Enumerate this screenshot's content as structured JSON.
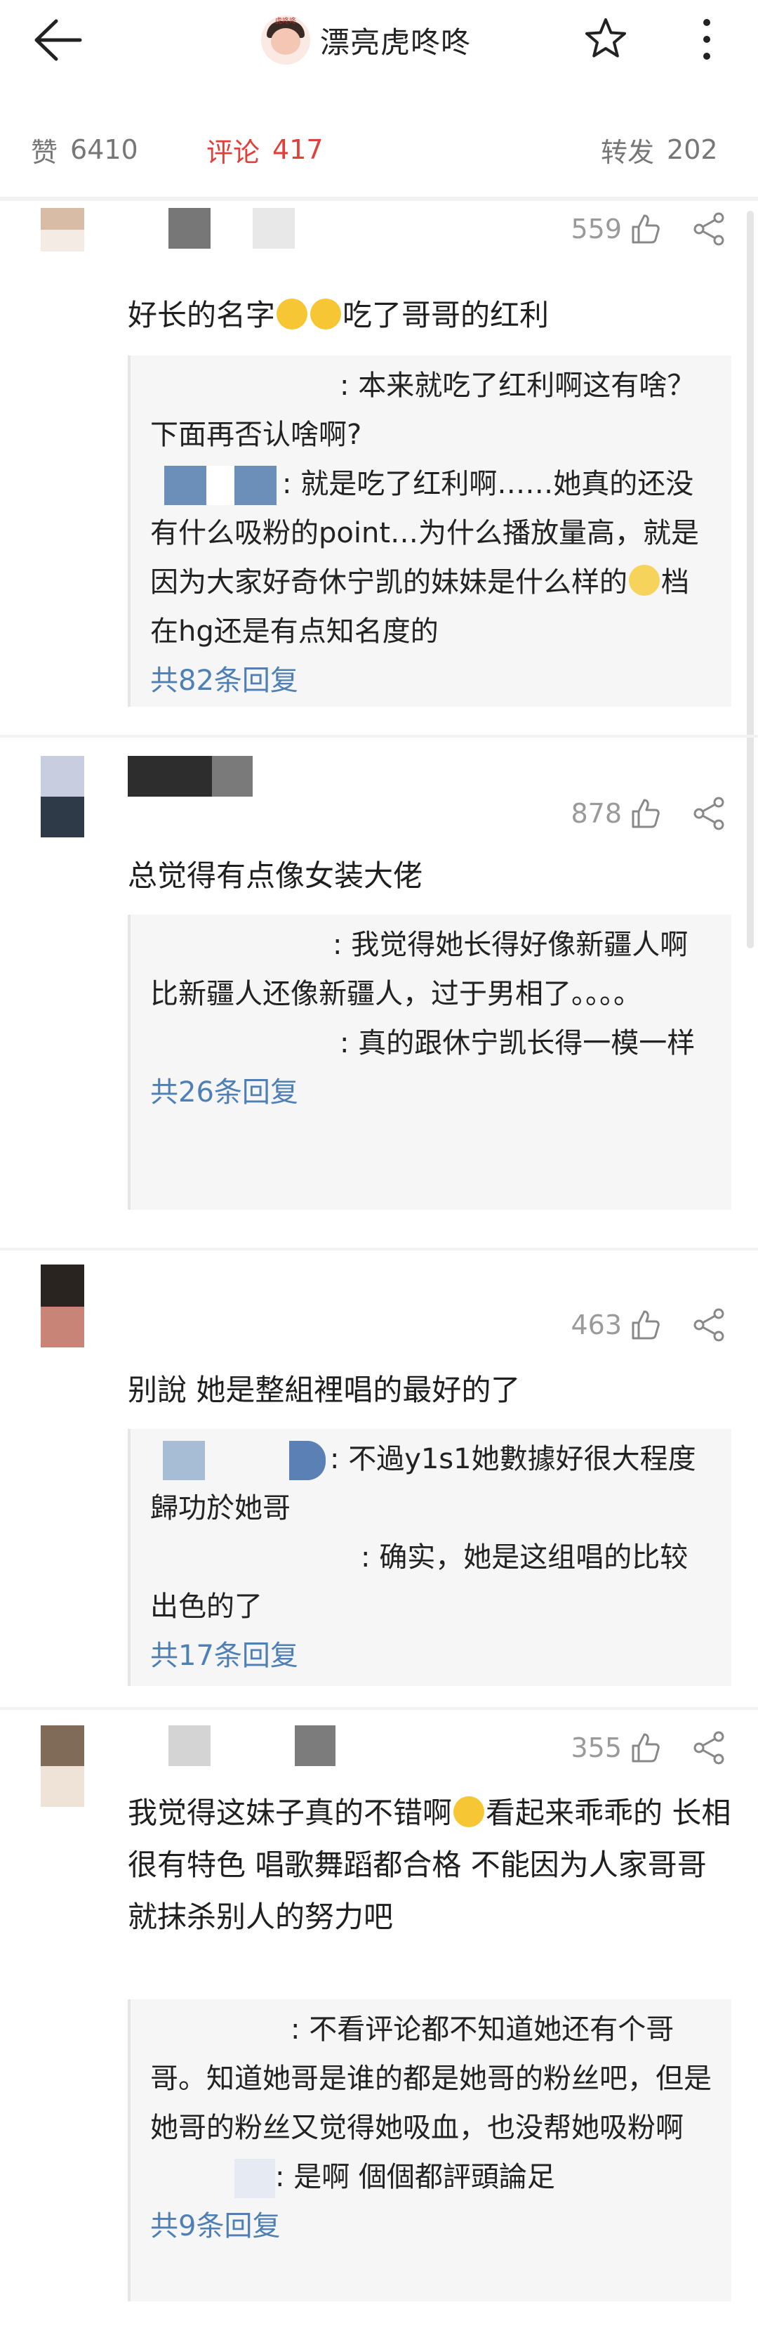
{
  "header": {
    "title": "漂亮虎咚咚",
    "avatar_tag": "虎咚咚"
  },
  "stats": {
    "likes_label": "赞",
    "likes_count": "6410",
    "comments_label": "评论",
    "comments_count": "417",
    "reposts_label": "转发",
    "reposts_count": "202"
  },
  "comments": [
    {
      "likes": "559",
      "text": "好长的名字",
      "text_after": "吃了哥哥的红利",
      "replies": [
        {
          "text": ": 本来就吃了红利啊这有啥？下面再否认啥啊?"
        },
        {
          "text": ": 就是吃了红利啊……她真的还没有什么吸粉的point…为什么播放量高，就是因为大家好奇休宁凯的妹妹是什么样的",
          "text_after": "档在hg还是有点知名度的"
        }
      ],
      "reply_count": "共82条回复"
    },
    {
      "likes": "878",
      "text": "总觉得有点像女装大佬",
      "replies": [
        {
          "text": ": 我觉得她长得好像新疆人啊 比新疆人还像新疆人，过于男相了。。。。"
        },
        {
          "text": ": 真的跟休宁凯长得一模一样"
        }
      ],
      "reply_count": "共26条回复"
    },
    {
      "likes": "463",
      "text": "别說 她是整組裡唱的最好的了",
      "replies": [
        {
          "text": ": 不過y1s1她數據好很大程度歸功於她哥"
        },
        {
          "text": ": 确实，她是这组唱的比较出色的了"
        }
      ],
      "reply_count": "共17条回复"
    },
    {
      "likes": "355",
      "text": "我觉得这妹子真的不错啊",
      "text_after": "看起来乖乖的 长相很有特色 唱歌舞蹈都合格 不能因为人家哥哥就抹杀别人的努力吧",
      "replies": [
        {
          "text": ": 不看评论都不知道她还有个哥哥。知道她哥是谁的都是她哥的粉丝吧，但是她哥的粉丝又觉得她吸血，也没帮她吸粉啊"
        },
        {
          "text": ": 是啊 個個都評頭論足"
        }
      ],
      "reply_count": "共9条回复"
    }
  ],
  "colors": {
    "accent_red": "#e0403a",
    "link_blue": "#4e7fb5",
    "muted_gray": "#9a9a9a"
  },
  "icons": [
    "back-arrow-icon",
    "star-icon",
    "more-vertical-icon",
    "thumbs-up-icon",
    "share-icon"
  ]
}
